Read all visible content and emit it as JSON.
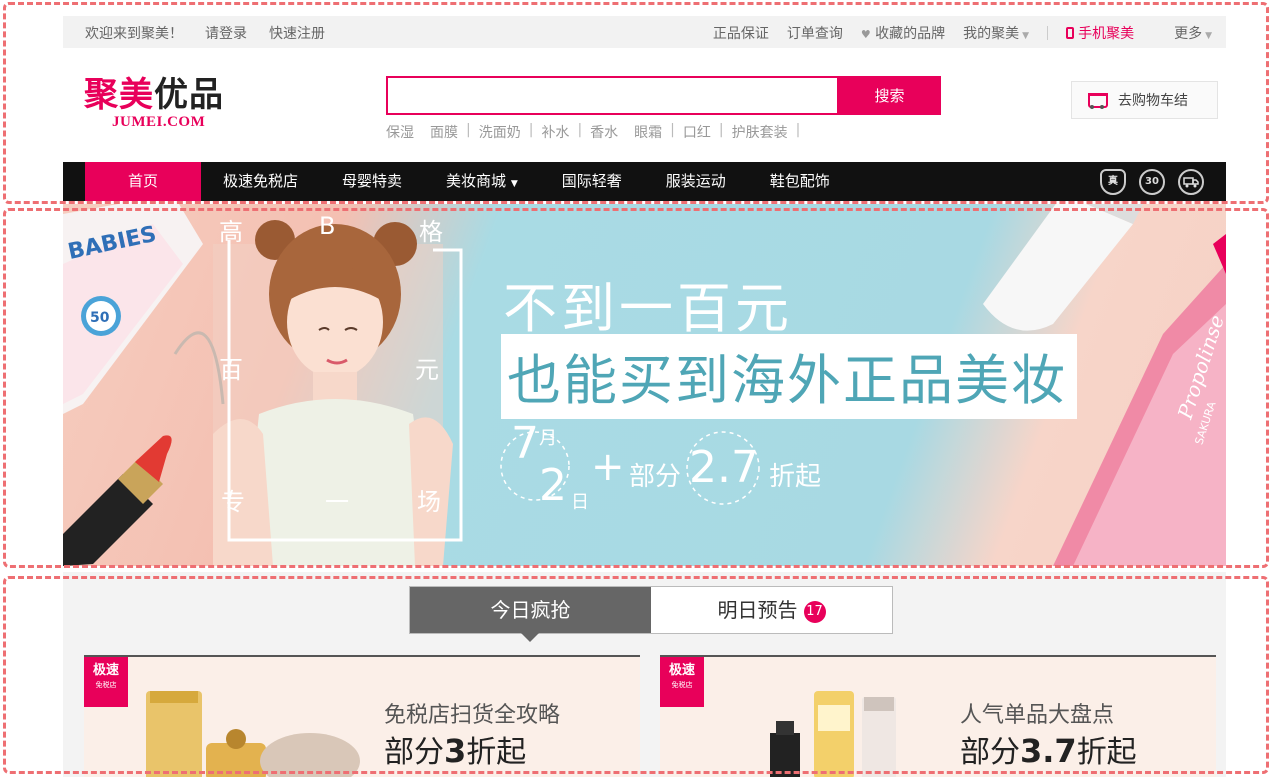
{
  "topbar": {
    "welcome": "欢迎来到聚美！",
    "login": "请登录",
    "register": "快速注册",
    "links": [
      "正品保证",
      "订单查询",
      "收藏的品牌",
      "我的聚美"
    ],
    "mobile": "手机聚美",
    "more": "更多"
  },
  "header": {
    "logo_cn_a": "聚美",
    "logo_cn_b": "优品",
    "logo_en": "JUMEI.COM",
    "search_button": "搜索",
    "search_placeholder": "",
    "hotwords": [
      "保湿",
      "面膜",
      "洗面奶",
      "补水",
      "香水",
      "眼霜",
      "口红",
      "护肤套装"
    ],
    "cart_label": "去购物车结"
  },
  "nav": {
    "items": [
      "首页",
      "极速免税店",
      "母婴特卖",
      "美妆商城",
      "国际轻奢",
      "服装运动",
      "鞋包配饰"
    ],
    "badges": [
      "真",
      "30"
    ]
  },
  "hero": {
    "frame_chars": [
      "高",
      "B",
      "格",
      "百",
      "元",
      "专",
      "一",
      "场"
    ],
    "line1": "不到一百元",
    "line2": "也能买到海外正品美妆",
    "month": "7",
    "month_suffix": "月",
    "day": "2",
    "day_suffix": "日",
    "plus": "+",
    "promo_prefix": "部分",
    "promo_num": "2.7",
    "promo_suffix": "折起",
    "product_left": "BABIES",
    "product_left_num": "50",
    "product_right": "Propolinse",
    "product_right_sub": "SAKURA"
  },
  "deals": {
    "tabs": [
      "今日疯抢",
      "明日预告"
    ],
    "preview_count": "17",
    "cards": [
      {
        "tag": "极速",
        "tag_sub": "免税店",
        "subtitle": "免税店扫货全攻略",
        "prefix": "部分",
        "num": "3",
        "suffix": "折起"
      },
      {
        "tag": "极速",
        "tag_sub": "免税店",
        "subtitle": "人气单品大盘点",
        "prefix": "部分",
        "num": "3.7",
        "suffix": "折起"
      }
    ]
  },
  "colors": {
    "brand": "#e8005a",
    "nav_bg": "#111111",
    "tab_active": "#666666"
  }
}
